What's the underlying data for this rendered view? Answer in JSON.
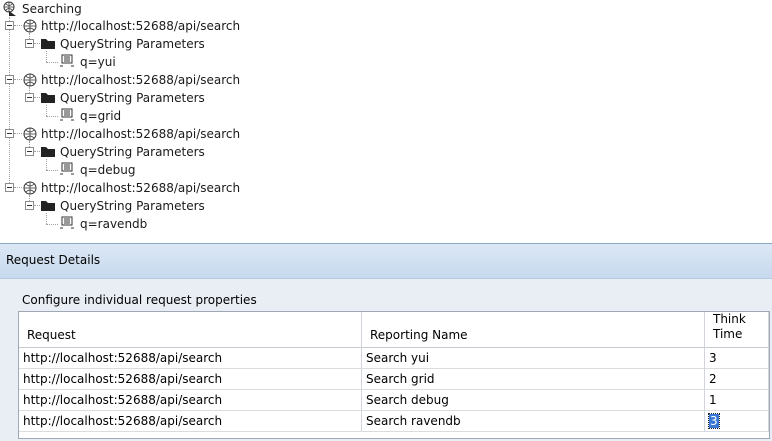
{
  "tree": {
    "root_label": "Searching",
    "requests": [
      {
        "url": "http://localhost:52688/api/search",
        "group_label": "QueryString Parameters",
        "param": "q=yui"
      },
      {
        "url": "http://localhost:52688/api/search",
        "group_label": "QueryString Parameters",
        "param": "q=grid"
      },
      {
        "url": "http://localhost:52688/api/search",
        "group_label": "QueryString Parameters",
        "param": "q=debug"
      },
      {
        "url": "http://localhost:52688/api/search",
        "group_label": "QueryString Parameters",
        "param": "q=ravendb"
      }
    ]
  },
  "dialog": {
    "title": "Request Details",
    "subtitle": "Configure individual request properties",
    "columns": [
      "Request",
      "Reporting Name",
      "Think Time"
    ],
    "rows": [
      {
        "request": "http://localhost:52688/api/search",
        "reporting_name": "Search yui",
        "think_time": "3"
      },
      {
        "request": "http://localhost:52688/api/search",
        "reporting_name": "Search grid",
        "think_time": "2"
      },
      {
        "request": "http://localhost:52688/api/search",
        "reporting_name": "Search debug",
        "think_time": "1"
      },
      {
        "request": "http://localhost:52688/api/search",
        "reporting_name": "Search ravendb",
        "think_time": "3"
      }
    ]
  },
  "colors": {
    "selection": "#3a78d6",
    "title_bar": "#c7d9ee",
    "dialog_body": "#e9eef5"
  }
}
